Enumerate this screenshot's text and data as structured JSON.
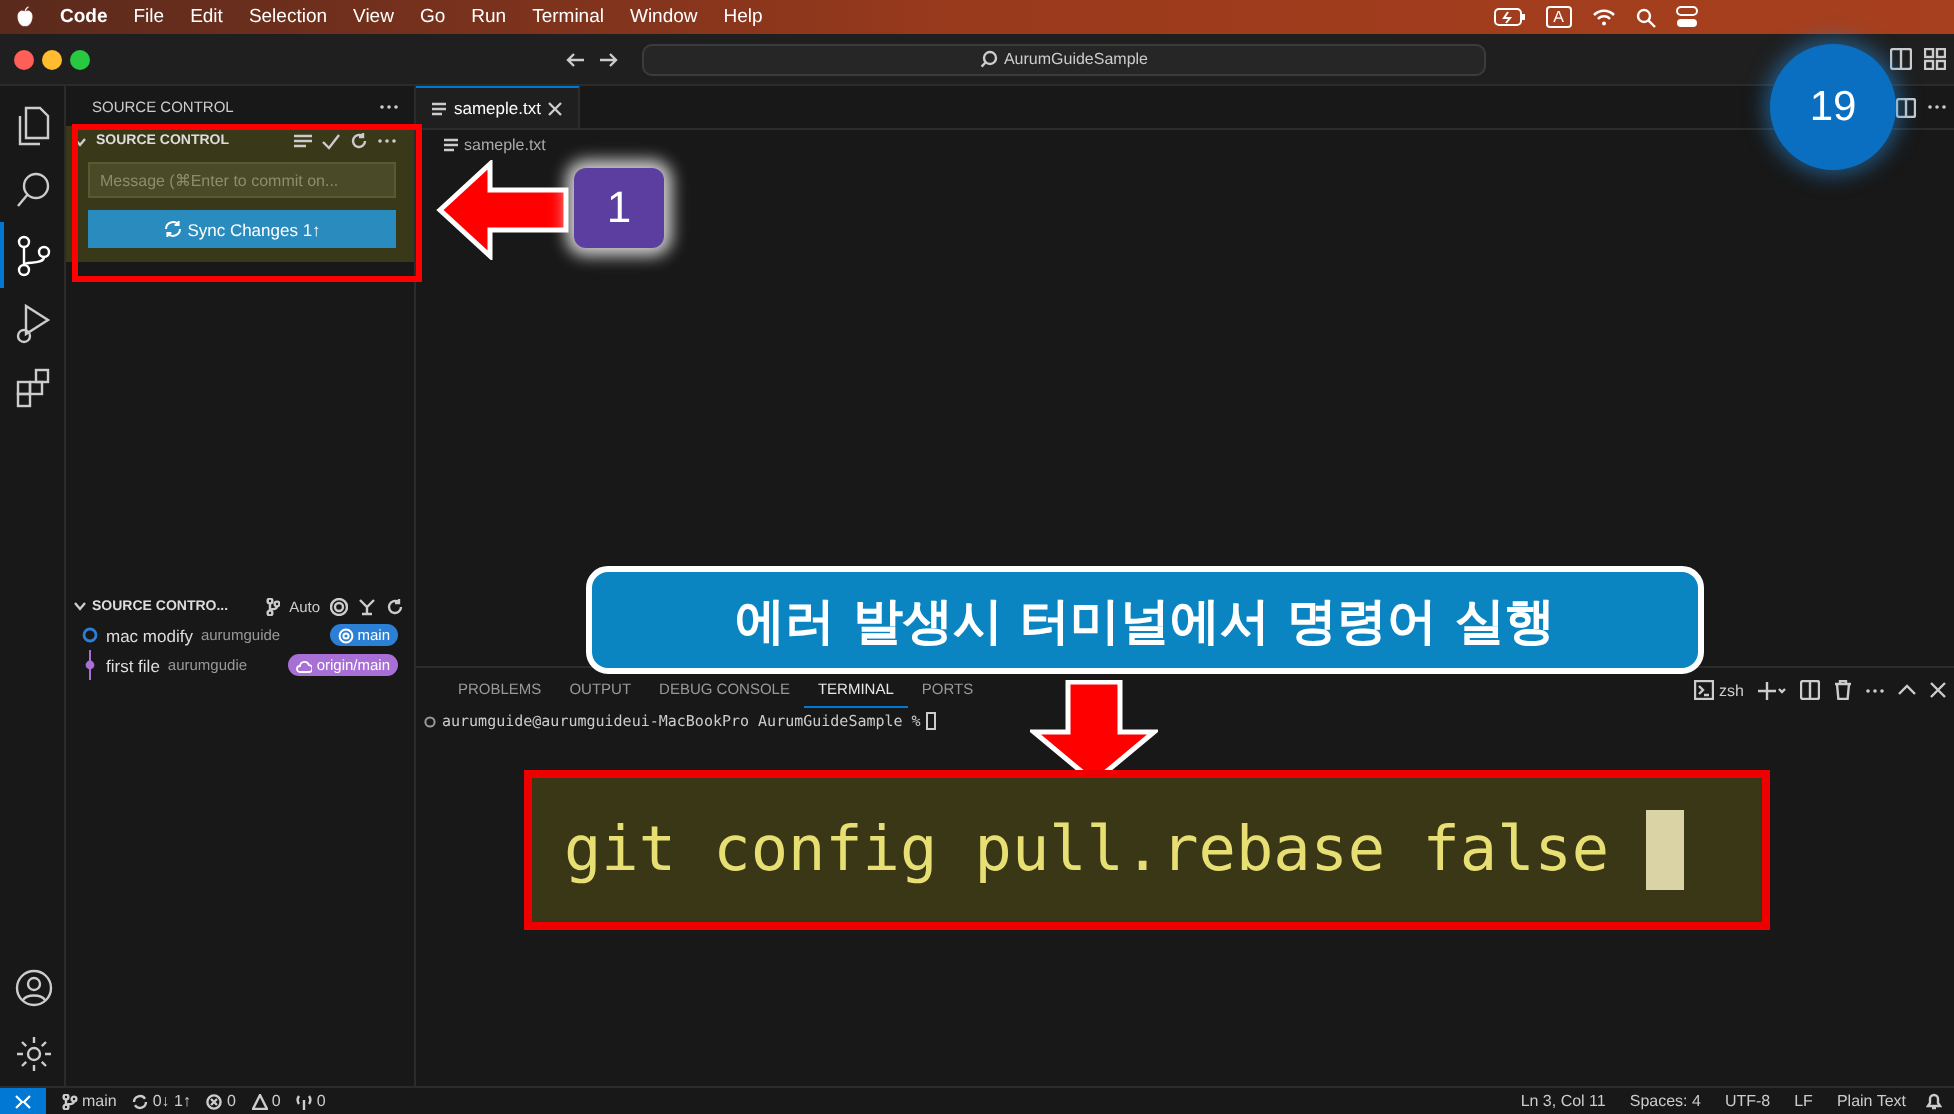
{
  "menu_bar": {
    "app": "Code",
    "items": [
      "File",
      "Edit",
      "Selection",
      "View",
      "Go",
      "Run",
      "Terminal",
      "Window",
      "Help"
    ],
    "input_source": "A"
  },
  "title_bar": {
    "search": "AurumGuideSample"
  },
  "activity_bar": {
    "items": [
      {
        "kind": "explorer",
        "selected": false
      },
      {
        "kind": "search",
        "selected": false
      },
      {
        "kind": "scm",
        "selected": true
      },
      {
        "kind": "debug",
        "selected": false
      },
      {
        "kind": "extensions",
        "selected": false
      }
    ]
  },
  "sidebar": {
    "title": "SOURCE CONTROL",
    "section": {
      "title": "SOURCE CONTROL",
      "message_placeholder": "Message (⌘Enter to commit on...",
      "button": "Sync Changes 1↑"
    },
    "graph": {
      "title": "SOURCE CONTRO...",
      "mode": "Auto",
      "commits": [
        {
          "message": "mac modify",
          "author": "aurumguide",
          "ref": "main",
          "kind": "local",
          "color": "#2b7fd4"
        },
        {
          "message": "first file",
          "author": "aurumgudie",
          "ref": "origin/main",
          "kind": "remote",
          "color": "#a86fd6"
        }
      ]
    }
  },
  "editor": {
    "tabs": [
      {
        "label": "sameple.txt",
        "selected": true
      }
    ],
    "breadcrumb": "sameple.txt"
  },
  "panel": {
    "tabs": [
      {
        "label": "PROBLEMS",
        "selected": false
      },
      {
        "label": "OUTPUT",
        "selected": false
      },
      {
        "label": "DEBUG CONSOLE",
        "selected": false
      },
      {
        "label": "TERMINAL",
        "selected": true
      },
      {
        "label": "PORTS",
        "selected": false
      }
    ],
    "shell": "zsh",
    "terminal_lines": [
      "aurumguide@aurumguideui-MacBookPro AurumGuideSample %"
    ]
  },
  "status_bar": {
    "branch": "main",
    "sync": "0↓ 1↑",
    "errors": "0",
    "warnings": "0",
    "ports": "0",
    "right": [
      "Ln 3, Col 11",
      "Spaces: 4",
      "UTF-8",
      "LF",
      "Plain Text"
    ]
  },
  "annotations": {
    "step_badge": "1",
    "page_badge": "19",
    "callout": "에러 발생시 터미널에서 명령어 실행",
    "command": "git config pull.rebase false"
  }
}
